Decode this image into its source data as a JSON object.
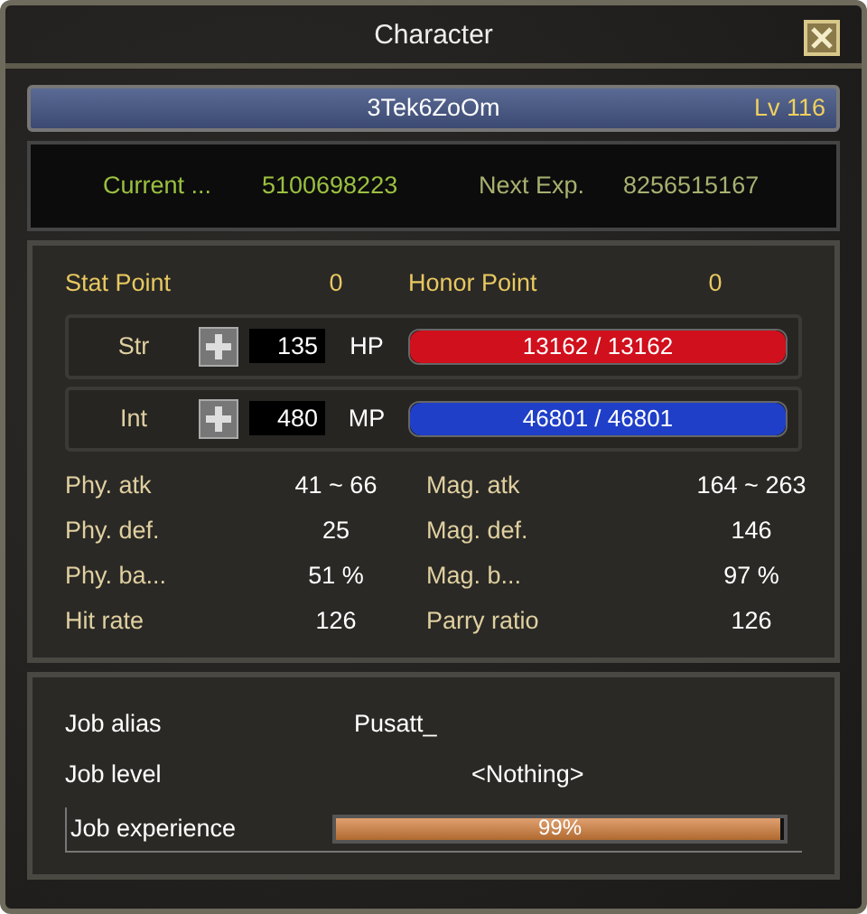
{
  "window": {
    "title": "Character"
  },
  "character": {
    "name": "3Tek6ZoOm",
    "level": "Lv 116"
  },
  "experience": {
    "current_label": "Current ...",
    "current_value": "5100698223",
    "next_label": "Next Exp.",
    "next_value": "8256515167"
  },
  "points": [
    {
      "label": "Stat Point",
      "value": "0"
    },
    {
      "label": "Honor Point",
      "value": "0"
    }
  ],
  "stats": [
    {
      "label": "Str",
      "value": "135",
      "bar_label": "HP",
      "bar_text": "13162 / 13162",
      "level": 1,
      "color": "#d0101c"
    },
    {
      "label": "Int",
      "value": "480",
      "bar_label": "MP",
      "bar_text": "46801 / 46801",
      "level": 1,
      "color": "#1f3fc8"
    }
  ],
  "attributes": [
    {
      "label": "Phy. atk",
      "value": "41 ~ 66"
    },
    {
      "label": "Mag. atk",
      "value": "164 ~ 263"
    },
    {
      "label": "Phy. def.",
      "value": "25"
    },
    {
      "label": "Mag. def.",
      "value": "146"
    },
    {
      "label": "Phy. ba...",
      "value": "51 %"
    },
    {
      "label": "Mag. b...",
      "value": "97 %"
    },
    {
      "label": "Hit rate",
      "value": "126"
    },
    {
      "label": "Parry ratio",
      "value": "126"
    }
  ],
  "job": {
    "alias_label": "Job alias",
    "alias_value": "Pusatt_",
    "level_label": "Job level",
    "level_value": "<Nothing>",
    "experience_label": "Job experience",
    "experience_text": "99%",
    "level": 0.99
  }
}
